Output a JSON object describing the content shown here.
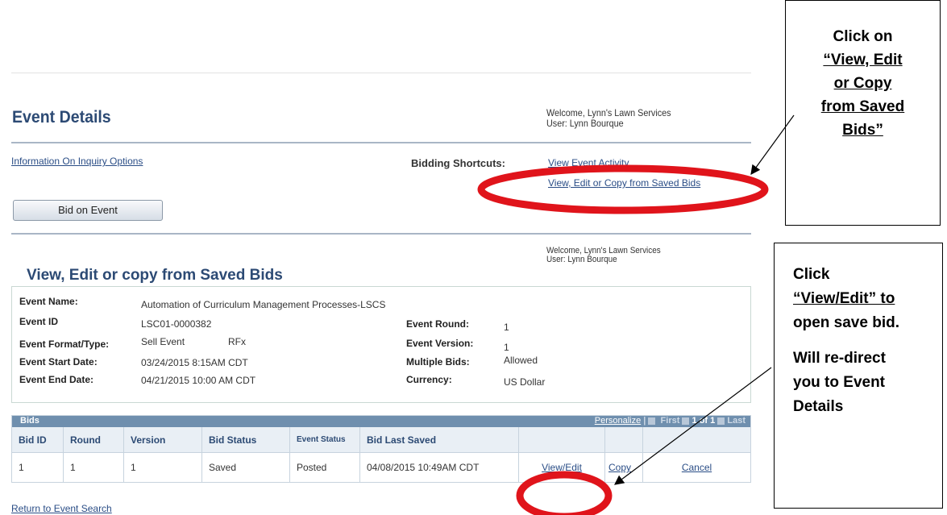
{
  "event_details": {
    "title": "Event Details",
    "welcome": "Welcome, Lynn's Lawn Services",
    "user": "User: Lynn Bourque",
    "info_link": "Information On Inquiry Options",
    "shortcuts_label": "Bidding Shortcuts:",
    "shortcut_view_activity": "View Event Activity",
    "shortcut_saved_bids": "View, Edit or Copy from Saved Bids",
    "bid_button": "Bid on Event"
  },
  "saved_bids": {
    "welcome": "Welcome, Lynn's Lawn Services",
    "user": "User: Lynn Bourque",
    "title": "View, Edit or copy from Saved Bids",
    "fields": {
      "event_name_label": "Event Name:",
      "event_name": "Automation of Curriculum Management Processes-LSCS",
      "event_id_label": "Event ID",
      "event_id": "LSC01-0000382",
      "format_label": "Event Format/Type:",
      "format": "Sell Event",
      "type": "RFx",
      "start_label": "Event Start Date:",
      "start": "03/24/2015  8:15AM CDT",
      "end_label": "Event End Date:",
      "end": "04/21/2015 10:00 AM CDT",
      "round_label": "Event Round:",
      "round": "1",
      "version_label": "Event Version:",
      "version": "1",
      "multiple_label": "Multiple Bids:",
      "multiple": "Allowed",
      "currency_label": "Currency:",
      "currency": "US Dollar"
    },
    "grid": {
      "title": "Bids",
      "personalize": "Personalize",
      "first": "First",
      "page": "1 of 1",
      "last": "Last",
      "columns": [
        "Bid ID",
        "Round",
        "Version",
        "Bid Status",
        "Event Status",
        "Bid Last Saved",
        "",
        "",
        ""
      ],
      "row": {
        "bid_id": "1",
        "round": "1",
        "version": "1",
        "bid_status": "Saved",
        "event_status": "Posted",
        "last_saved": "04/08/2015 10:49AM CDT",
        "view_edit": "View/Edit",
        "copy": "Copy",
        "cancel": "Cancel"
      }
    },
    "return_link": "Return to Event Search"
  },
  "callouts": {
    "c1_line1": "Click on",
    "c1_line2": "“View, Edit",
    "c1_line3": "or Copy",
    "c1_line4": "from Saved",
    "c1_line5": "Bids”",
    "c2_line1": "Click",
    "c2_line2": "“View/Edit” to",
    "c2_line3": "open save bid.",
    "c2_line4": "Will re-direct",
    "c2_line5": "you to Event",
    "c2_line6": "Details"
  },
  "colors": {
    "title": "#2c4a74",
    "link": "#2a4d86",
    "grid_header": "#6f8fae",
    "highlight": "#e0141b"
  }
}
